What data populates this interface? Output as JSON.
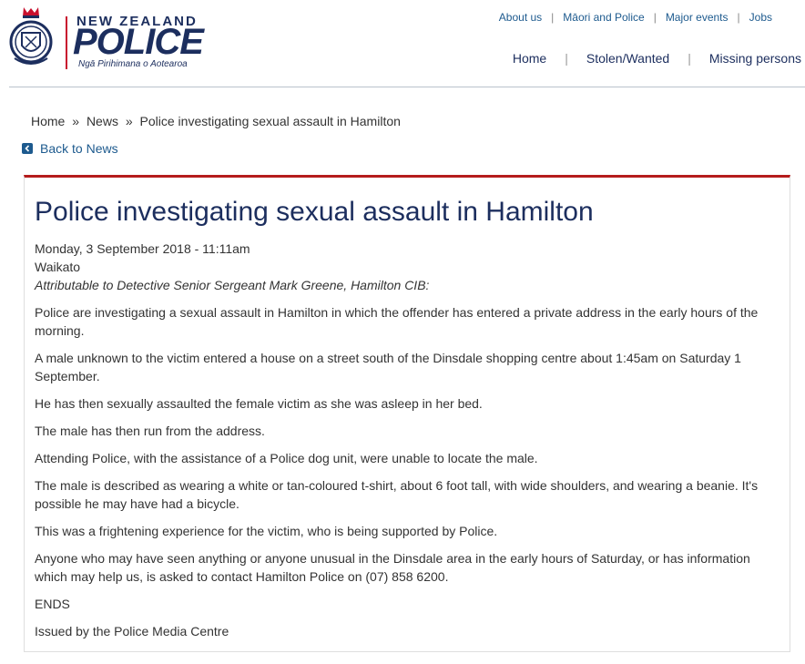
{
  "logo": {
    "top_text": "NEW ZEALAND",
    "main_text": "POLICE",
    "sub_text": "Ngā Pirihimana o Aotearoa"
  },
  "utility_nav": [
    "About us",
    "Māori and Police",
    "Major events",
    "Jobs"
  ],
  "main_nav": [
    "Home",
    "Stolen/Wanted",
    "Missing persons"
  ],
  "breadcrumb": {
    "items": [
      "Home",
      "News",
      "Police investigating sexual assault in Hamilton"
    ],
    "separator": "»"
  },
  "back_link": "Back to News",
  "article": {
    "title": "Police investigating sexual assault in Hamilton",
    "date": "Monday, 3 September 2018 - 11:11am",
    "region": "Waikato",
    "attribution": "Attributable to Detective Senior Sergeant Mark Greene, Hamilton CIB:",
    "paragraphs": [
      "Police are investigating a sexual assault in Hamilton in which the offender has entered a private address in the early hours of the morning.",
      "A male unknown to the victim entered a house on a street south of the Dinsdale shopping centre about 1:45am on Saturday 1 September.",
      "He has then sexually assaulted the female victim as she was asleep in her bed.",
      "The male has then run from the address.",
      "Attending Police, with the assistance of a Police dog unit, were unable to locate the male.",
      "The male is described as wearing a white or tan-coloured t-shirt, about 6 foot tall, with wide shoulders, and wearing a beanie. It's possible he may have had a bicycle.",
      "This was a frightening experience for the victim, who is being supported by Police.",
      "Anyone who may have seen anything or anyone unusual in the Dinsdale area in the early hours of Saturday, or has information which may help us, is asked to contact Hamilton Police on (07) 858 6200.",
      "ENDS",
      "Issued by the Police Media Centre"
    ]
  },
  "colors": {
    "brand_navy": "#1c2e5e",
    "link_blue": "#1d5a8e",
    "accent_red": "#b51c1c"
  }
}
